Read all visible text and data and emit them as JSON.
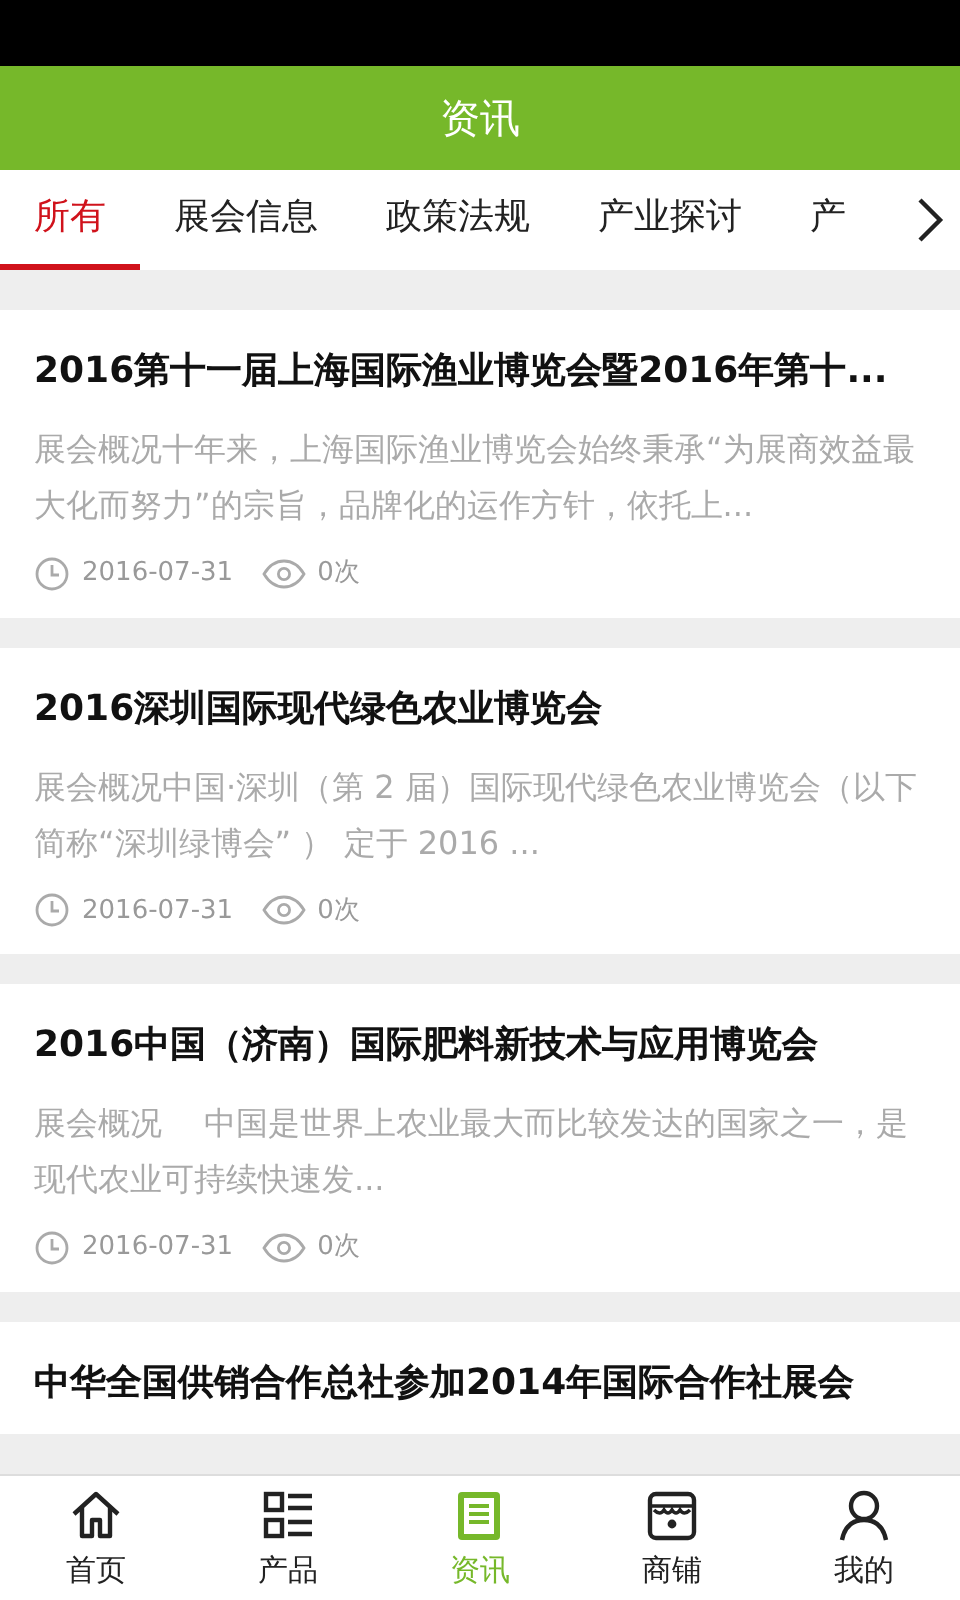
{
  "header": {
    "title": "资讯"
  },
  "tabs": [
    {
      "label": "所有",
      "selected": true
    },
    {
      "label": "展会信息",
      "selected": false
    },
    {
      "label": "政策法规",
      "selected": false
    },
    {
      "label": "产业探讨",
      "selected": false
    },
    {
      "label": "产",
      "selected": false
    }
  ],
  "articles": [
    {
      "title": "2016第十一届上海国际渔业博览会暨2016年第十...",
      "excerpt": "展会概况十年来，上海国际渔业博览会始终秉承“为展商效益最大化而努力”的宗旨，品牌化的运作方针，依托上...",
      "date": "2016-07-31",
      "views": "0次"
    },
    {
      "title": "2016深圳国际现代绿色农业博览会",
      "excerpt": "展会概况中国·深圳（第 2 届）国际现代绿色农业博览会（以下简称“深圳绿博会” ） 定于 2016 ...",
      "date": "2016-07-31",
      "views": "0次"
    },
    {
      "title": "2016中国（济南）国际肥料新技术与应用博览会",
      "excerpt": "展会概况　 中国是世界上农业最大而比较发达的国家之一，是现代农业可持续快速发...",
      "date": "2016-07-31",
      "views": "0次"
    },
    {
      "title": "中华全国供销合作总社参加2014年国际合作社展会"
    }
  ],
  "bottom_nav": [
    {
      "kind": "home",
      "label": "首页",
      "selected": false
    },
    {
      "kind": "products",
      "label": "产品",
      "selected": false
    },
    {
      "kind": "news",
      "label": "资讯",
      "selected": true
    },
    {
      "kind": "shop",
      "label": "商铺",
      "selected": false
    },
    {
      "kind": "me",
      "label": "我的",
      "selected": false
    }
  ]
}
